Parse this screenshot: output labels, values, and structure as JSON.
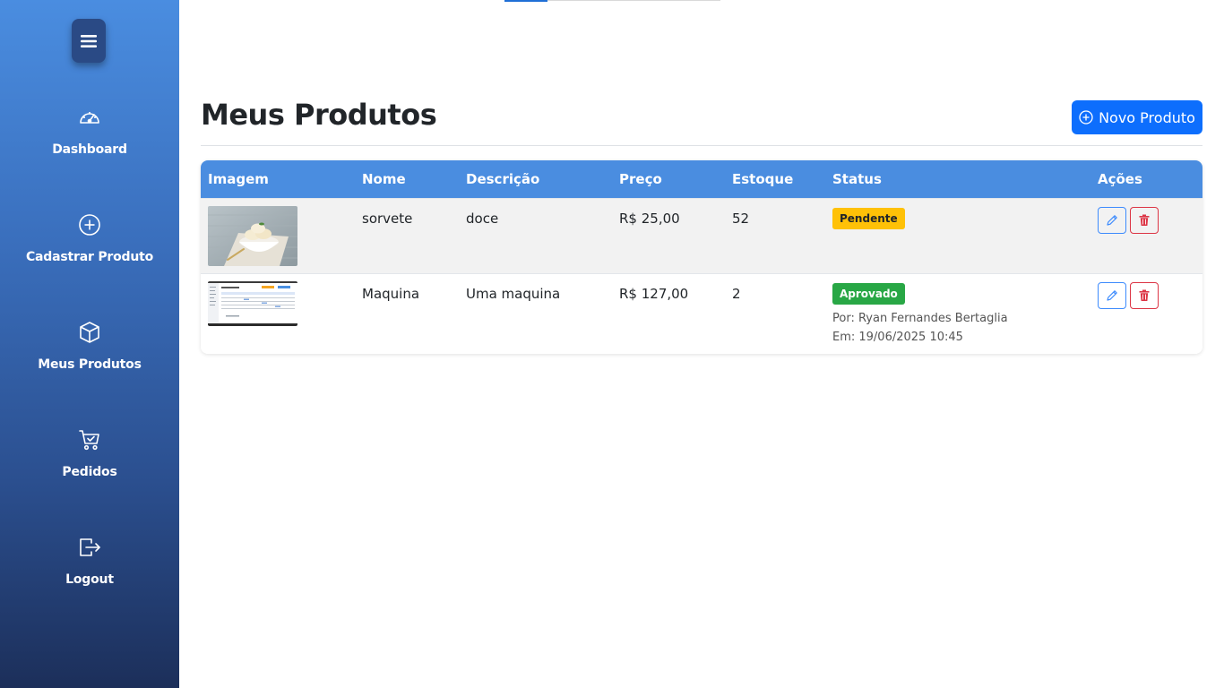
{
  "sidebar": {
    "items": [
      {
        "label": "Dashboard",
        "icon": "gauge-icon"
      },
      {
        "label": "Cadastrar Produto",
        "icon": "plus-circle-icon"
      },
      {
        "label": "Meus Produtos",
        "icon": "box-icon"
      },
      {
        "label": "Pedidos",
        "icon": "cart-check-icon"
      },
      {
        "label": "Logout",
        "icon": "logout-icon"
      }
    ]
  },
  "header": {
    "title": "Meus Produtos",
    "new_button_label": "Novo Produto"
  },
  "table": {
    "columns": [
      "Imagem",
      "Nome",
      "Descrição",
      "Preço",
      "Estoque",
      "Status",
      "Ações"
    ],
    "rows": [
      {
        "nome": "sorvete",
        "descricao": "doce",
        "preco": "R$ 25,00",
        "estoque": "52",
        "status": "Pendente"
      },
      {
        "nome": "Maquina",
        "descricao": "Uma maquina",
        "preco": "R$ 127,00",
        "estoque": "2",
        "status": "Aprovado",
        "aprovado_por": "Por: Ryan Fernandes Bertaglia",
        "aprovado_em": "Em: 19/06/2025 10:45"
      }
    ]
  },
  "colors": {
    "primary": "#0d6efd",
    "table_header": "#4a8de0",
    "warning": "#ffc107",
    "success": "#28a745",
    "danger": "#dc3545"
  }
}
